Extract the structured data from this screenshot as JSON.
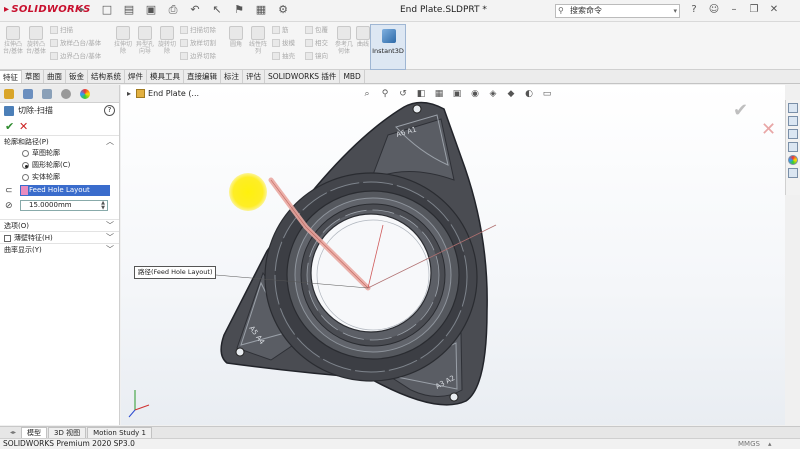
{
  "app": {
    "logo": "SOLIDWORKS",
    "file_title": "End Plate.SLDPRT *",
    "search_placeholder": "搜索命令"
  },
  "ribbon": {
    "buttons": [
      {
        "label": "拉伸凸台/基体"
      },
      {
        "label": "旋转凸台/基体"
      },
      {
        "label": "扫描"
      },
      {
        "label": "放样凸台/基体"
      },
      {
        "label": "边界凸台/基体"
      },
      {
        "label": "拉伸切除"
      },
      {
        "label": "异型孔向导"
      },
      {
        "label": "旋转切除"
      },
      {
        "label": "扫描切除"
      },
      {
        "label": "放样切割"
      },
      {
        "label": "边界切除"
      },
      {
        "label": "圆角"
      },
      {
        "label": "线性阵列"
      },
      {
        "label": "筋"
      },
      {
        "label": "拔模"
      },
      {
        "label": "抽壳"
      },
      {
        "label": "包覆"
      },
      {
        "label": "相交"
      },
      {
        "label": "镜向"
      },
      {
        "label": "参考几何体"
      },
      {
        "label": "曲线"
      }
    ],
    "instant3d": "Instant3D"
  },
  "tabs": [
    "特征",
    "草图",
    "曲面",
    "钣金",
    "结构系统",
    "焊件",
    "模具工具",
    "直接编辑",
    "标注",
    "评估",
    "SOLIDWORKS 插件",
    "MBD"
  ],
  "property_manager": {
    "title": "切除-扫描",
    "section_profile": "轮廓和路径(P)",
    "radio_sketch": "草图轮廓",
    "radio_circle": "圆形轮廓(C)",
    "radio_solid": "实体轮廓",
    "path_value": "Feed Hole Layout",
    "diameter_value": "15.0000mm",
    "section_options": "选项(O)",
    "section_thin": "薄壁特征(H)",
    "section_curvature": "曲率显示(Y)"
  },
  "viewport": {
    "tree_item": "End Plate  (...",
    "callout": "路径(Feed Hole Layout)",
    "labels": [
      "A6 A1",
      "A5 A4",
      "A3 A2"
    ]
  },
  "bottom_tabs": [
    "模型",
    "3D 视图",
    "Motion Study 1"
  ],
  "status": {
    "text": "SOLIDWORKS Premium 2020 SP3.0",
    "units": "MMGS"
  }
}
